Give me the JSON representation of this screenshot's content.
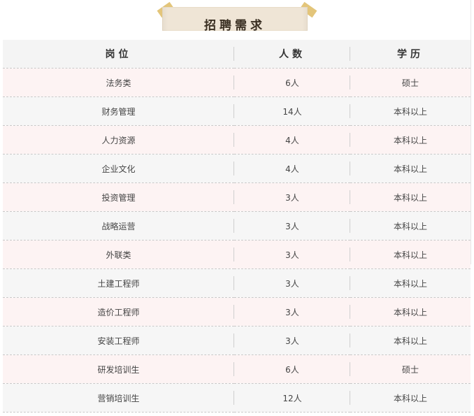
{
  "title": "招聘需求",
  "table": {
    "headers": [
      "岗位",
      "人数",
      "学历"
    ],
    "rows": [
      [
        "法务类",
        "6人",
        "硕士"
      ],
      [
        "财务管理",
        "14人",
        "本科以上"
      ],
      [
        "人力资源",
        "4人",
        "本科以上"
      ],
      [
        "企业文化",
        "4人",
        "本科以上"
      ],
      [
        "投资管理",
        "3人",
        "本科以上"
      ],
      [
        "战略运营",
        "3人",
        "本科以上"
      ],
      [
        "外联类",
        "3人",
        "本科以上"
      ],
      [
        "土建工程师",
        "3人",
        "本科以上"
      ],
      [
        "造价工程师",
        "3人",
        "本科以上"
      ],
      [
        "安装工程师",
        "3人",
        "本科以上"
      ],
      [
        "研发培训生",
        "6人",
        "硕士"
      ],
      [
        "营销培训生",
        "12人",
        "本科以上"
      ]
    ]
  },
  "colors": {
    "header_bg": "#f4f4f4",
    "row_pink": "#fdf3f3",
    "row_grey": "#f6f6f6",
    "banner": "#efe5d6",
    "tape": "#e3c57a"
  }
}
